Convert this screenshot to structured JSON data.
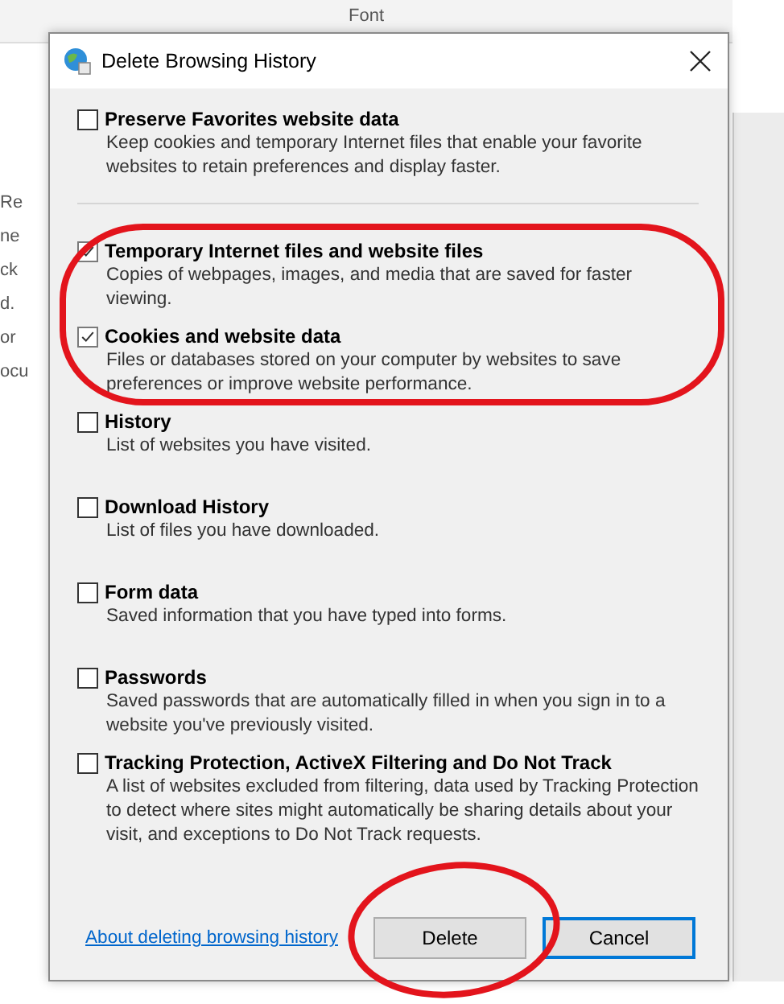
{
  "background": {
    "heading": "Font",
    "edge_fragments": [
      "Re",
      "ne",
      "ck",
      "d.",
      "or",
      "ocu"
    ]
  },
  "window": {
    "title": "Delete Browsing History"
  },
  "favorites": {
    "label": "Preserve Favorites website data",
    "description": "Keep cookies and temporary Internet files that enable your favorite websites to retain preferences and display faster.",
    "checked": false
  },
  "items": [
    {
      "label": "Temporary Internet files and website files",
      "description": "Copies of webpages, images, and media that are saved for faster viewing.",
      "checked": true
    },
    {
      "label": "Cookies and website data",
      "description": "Files or databases stored on your computer by websites to save preferences or improve website performance.",
      "checked": true
    },
    {
      "label": "History",
      "description": "List of websites you have visited.",
      "checked": false
    },
    {
      "label": "Download History",
      "description": "List of files you have downloaded.",
      "checked": false
    },
    {
      "label": "Form data",
      "description": "Saved information that you have typed into forms.",
      "checked": false
    },
    {
      "label": "Passwords",
      "description": "Saved passwords that are automatically filled in when you sign in to a website you've previously visited.",
      "checked": false
    },
    {
      "label": "Tracking Protection, ActiveX Filtering and Do Not Track",
      "description": "A list of websites excluded from filtering, data used by Tracking Protection to detect where sites might automatically be sharing details about your visit, and exceptions to Do Not Track requests.",
      "checked": false
    }
  ],
  "footer": {
    "link": "About deleting browsing history",
    "buttons": [
      {
        "label": "Delete",
        "default": false
      },
      {
        "label": "Cancel",
        "default": true
      }
    ]
  }
}
